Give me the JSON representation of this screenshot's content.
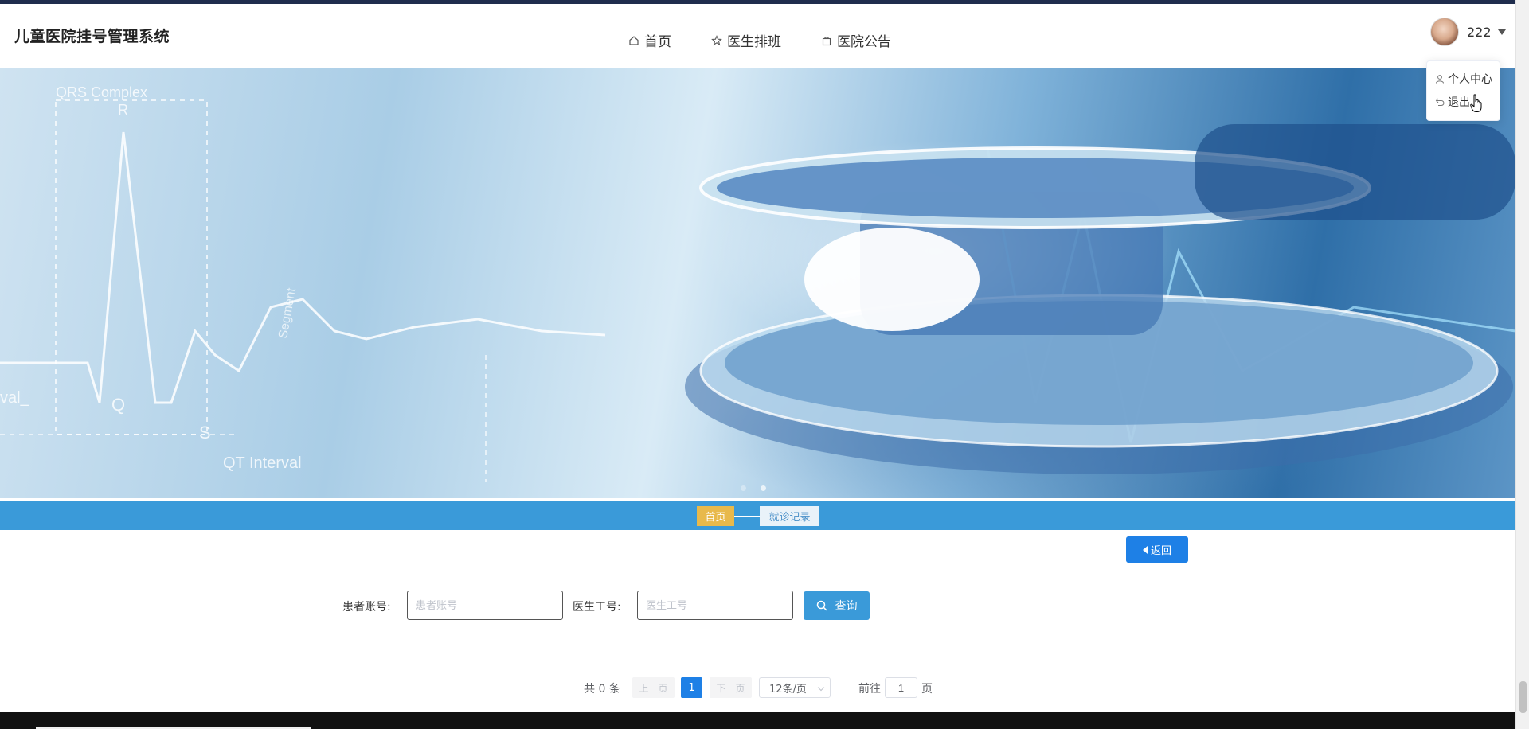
{
  "app": {
    "title": "儿童医院挂号管理系统"
  },
  "nav": {
    "home": "首页",
    "schedule": "医生排班",
    "notice": "医院公告"
  },
  "user": {
    "name": "222",
    "menu": {
      "profile": "个人中心",
      "logout": "退出"
    }
  },
  "breadcrumb": {
    "home": "首页",
    "current": "就诊记录"
  },
  "actions": {
    "back": "返回"
  },
  "search": {
    "patient_label": "患者账号:",
    "patient_placeholder": "患者账号",
    "doctor_label": "医生工号:",
    "doctor_placeholder": "医生工号",
    "query_label": "查询"
  },
  "pagination": {
    "total": "共 0 条",
    "prev": "上一页",
    "current_page": "1",
    "next": "下一页",
    "page_size": "12条/页",
    "goto_label": "前往",
    "goto_value": "1",
    "page_suffix": "页"
  },
  "banner": {
    "annotations": [
      "QRS Complex",
      "R",
      "Q",
      "S",
      "QT Interval",
      "val_",
      "Segment"
    ],
    "dot_count": 2,
    "active_dot": 0
  },
  "colors": {
    "primary": "#1e80e6",
    "breadcrumb_bar": "#3a9ad9",
    "breadcrumb_home": "#e8b94b"
  }
}
